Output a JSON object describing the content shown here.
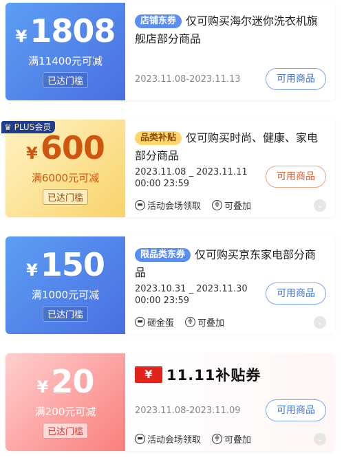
{
  "coupons": [
    {
      "currency": "¥",
      "amount": "1808",
      "condition": "满11400元可减",
      "threshold_badge": "已达门槛",
      "tag": "店铺东券",
      "title": "仅可购买海尔迷你洗衣机旗舰店部分商品",
      "date": "2023.11.08-2023.11.13",
      "button": "可用商品"
    },
    {
      "plus_badge": "PLUS会员",
      "currency": "¥",
      "amount": "600",
      "condition": "满6000元可减",
      "threshold_badge": "已达门槛",
      "tag": "品类补贴",
      "title": "仅可购买时尚、健康、家电部分商品",
      "date_line1": "2023.11.08 _ 2023.11.11",
      "date_line2": "00:00 23:59",
      "button": "可用商品",
      "meta": [
        "活动会场领取",
        "可叠加"
      ]
    },
    {
      "currency": "¥",
      "amount": "150",
      "condition": "满1000元可减",
      "threshold_badge": "已达门槛",
      "tag": "限品类东券",
      "title": "仅可购买京东家电部分商品",
      "date_line1": "2023.10.31 _ 2023.11.30",
      "date_line2": "00:00 23:59",
      "button": "可用商品",
      "meta": [
        "砸金蛋",
        "可叠加"
      ]
    },
    {
      "currency": "¥",
      "amount": "20",
      "condition": "满200元可减",
      "threshold_badge": "已达门槛",
      "logo_mark": "¥",
      "logo_text": "11.11补贴券",
      "date": "2023.11.08-2023.11.09",
      "button": "可用商品",
      "meta": [
        "活动会场领取",
        "可叠加"
      ]
    }
  ],
  "icons": {
    "venue": "ticket-icon",
    "stack": "stack-icon",
    "expand": "chevron-down-icon",
    "plus": "crown-icon"
  },
  "colors": {
    "blue": "#4a6fe0",
    "gold": "#f9d36a",
    "pink": "#f97f7c",
    "accent_blue": "#3f73e0",
    "accent_orange": "#e25e28"
  }
}
